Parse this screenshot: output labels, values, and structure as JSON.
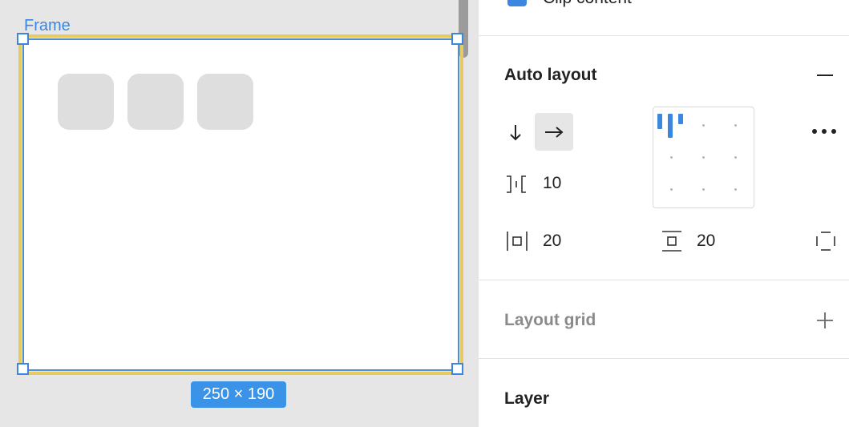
{
  "canvas": {
    "frame_label": "Frame",
    "size_badge": "250 × 190",
    "child_count": 3
  },
  "panel": {
    "clip_content": {
      "label": "Clip content",
      "checked": true
    },
    "auto_layout": {
      "title": "Auto layout",
      "remove_icon": "minus-icon",
      "direction_vertical_icon": "arrow-down-icon",
      "direction_horizontal_icon": "arrow-right-icon",
      "active_direction": "horizontal",
      "spacing_between": "10",
      "horizontal_padding": "20",
      "vertical_padding": "20",
      "alignment": "top-left",
      "more_icon": "more-horizontal-icon",
      "individual_padding_icon": "individual-padding-icon"
    },
    "layout_grid": {
      "title": "Layout grid",
      "add_icon": "plus-icon"
    },
    "layer": {
      "title": "Layer"
    }
  },
  "colors": {
    "accent": "#3b86de",
    "frame_selection": "#e8cb5e",
    "badge": "#3b93e8"
  }
}
